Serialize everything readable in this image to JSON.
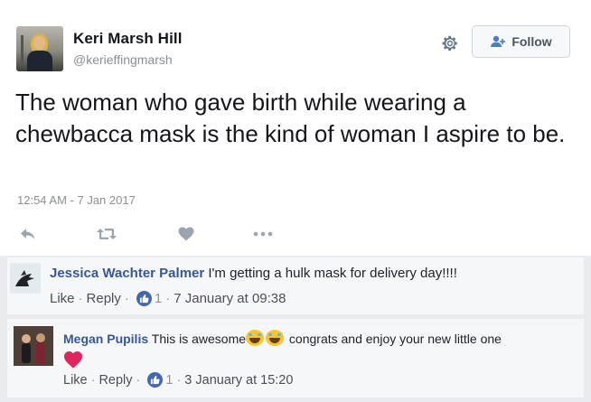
{
  "tweet": {
    "display_name": "Keri Marsh Hill",
    "handle": "@kerieffingmarsh",
    "follow_label": "Follow",
    "text": "The woman who gave birth while wearing a chewbacca mask is the kind of woman I aspire to be.",
    "timestamp": "12:54 AM - 7 Jan 2017",
    "icons": [
      "settings-gear-icon",
      "follow-person-icon",
      "reply-icon",
      "retweet-icon",
      "like-heart-icon",
      "more-icon"
    ]
  },
  "comments": [
    {
      "author": "Jessica Wachter Palmer",
      "text": "I'm getting a hulk mask for delivery day!!!!",
      "like_label": "Like",
      "reply_label": "Reply",
      "reaction_count": "1",
      "date": "7 January at 09:38"
    },
    {
      "author": "Megan Pupilis",
      "text_before": "This is awesome",
      "text_after": "congrats and enjoy your new little one",
      "emoji": [
        "tears-of-joy-emoji",
        "tears-of-joy-emoji"
      ],
      "heart_emoji": "red-heart",
      "like_label": "Like",
      "reply_label": "Reply",
      "reaction_count": "1",
      "date": "3 January at 15:20"
    }
  ],
  "colors": {
    "name_text": "#14171a",
    "muted_text": "#8a8f94",
    "fb_author": "#365899",
    "fb_like": "#4267b2",
    "heart": "#e0245e"
  }
}
